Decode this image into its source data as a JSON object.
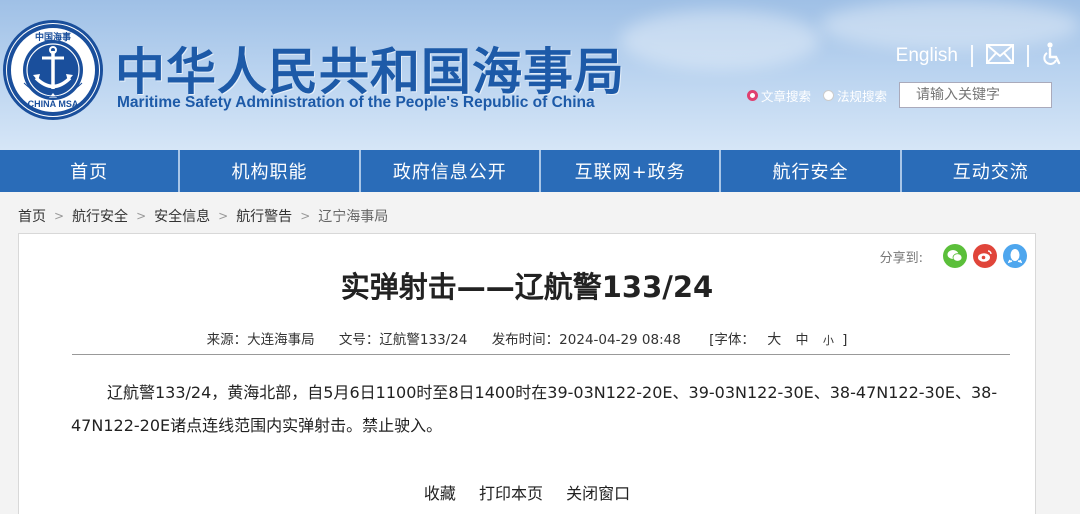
{
  "header": {
    "title_cn": "中华人民共和国海事局",
    "title_en": "Maritime Safety Administration of the People's Republic of China",
    "logo_text_top": "中国海事",
    "logo_text_bottom": "CHINA MSA",
    "english_link": "English",
    "icons": [
      "mail-icon",
      "accessibility-icon"
    ],
    "search": {
      "options": [
        "文章搜索",
        "法规搜索"
      ],
      "selected": "文章搜索",
      "placeholder": "请输入关键字"
    }
  },
  "nav": {
    "items": [
      "首页",
      "机构职能",
      "政府信息公开",
      "互联网+政务",
      "航行安全",
      "互动交流"
    ]
  },
  "breadcrumb": [
    "首页",
    "航行安全",
    "安全信息",
    "航行警告",
    "辽宁海事局"
  ],
  "article": {
    "share_label": "分享到:",
    "share_icons": [
      "wechat-icon",
      "weibo-icon",
      "qq-icon"
    ],
    "title": "实弹射击——辽航警133/24",
    "meta": {
      "source": "来源：大连海事局",
      "doc_no": "文号：辽航警133/24",
      "published": "发布时间：2024-04-29 08:48",
      "font_label": "[字体：",
      "font_large": "大",
      "font_medium": "中",
      "font_small": "小",
      "font_close": "]"
    },
    "body": "辽航警133/24，黄海北部，自5月6日1100时至8日1400时在39-03N122-20E、39-03N122-30E、38-47N122-30E、38-47N122-20E诸点连线范围内实弹射击。禁止驶入。",
    "actions": [
      "收藏",
      "打印本页",
      "关闭窗口"
    ]
  },
  "colors": {
    "nav_bg": "#2a6cb8",
    "brand_blue": "#1d5aa8",
    "wechat": "#5bbf3a",
    "weibo": "#e0453a",
    "qq": "#4ea6ee"
  }
}
